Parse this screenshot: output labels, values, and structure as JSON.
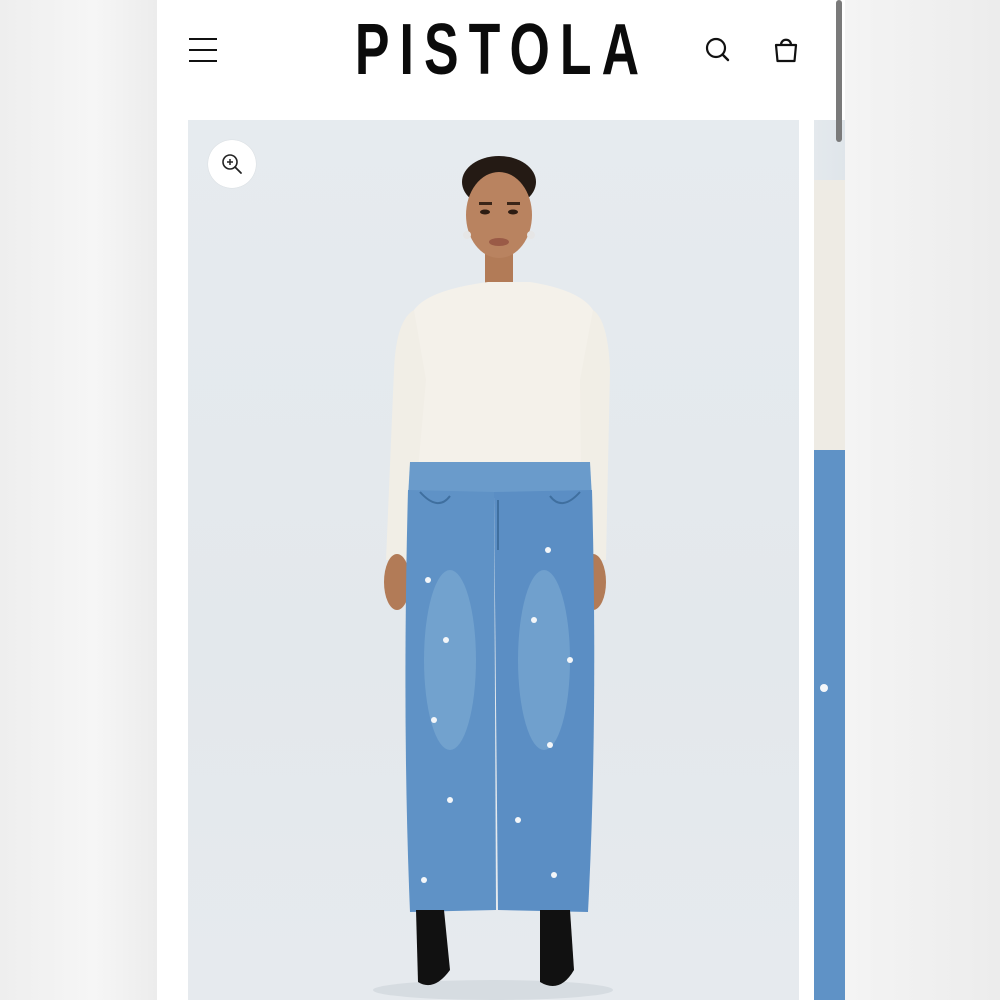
{
  "brand": {
    "name": "PISTOLA"
  },
  "header": {
    "menu_icon": "hamburger-menu-icon",
    "search_icon": "search-icon",
    "cart_icon": "shopping-bag-icon"
  },
  "gallery": {
    "zoom_icon": "zoom-in-icon",
    "image_description_hidden": ""
  },
  "colors": {
    "text": "#0b0b0b",
    "gallery_bg": "#e5eaee",
    "denim": "#5b8ec4",
    "top": "#f4f1ea"
  }
}
